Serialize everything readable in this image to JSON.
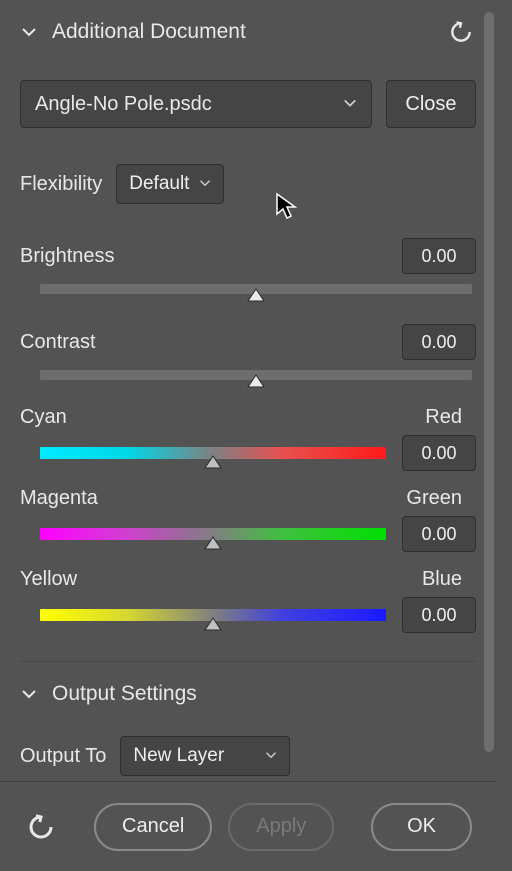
{
  "sections": {
    "additional_document": {
      "title": "Additional Document",
      "file_selected": "Angle-No Pole.psdc",
      "close_label": "Close",
      "flexibility_label": "Flexibility",
      "flexibility_value": "Default",
      "sliders": {
        "brightness": {
          "label": "Brightness",
          "value": "0.00"
        },
        "contrast": {
          "label": "Contrast",
          "value": "0.00"
        },
        "cyan_red": {
          "left": "Cyan",
          "right": "Red",
          "value": "0.00"
        },
        "mag_green": {
          "left": "Magenta",
          "right": "Green",
          "value": "0.00"
        },
        "yel_blue": {
          "left": "Yellow",
          "right": "Blue",
          "value": "0.00"
        }
      }
    },
    "output_settings": {
      "title": "Output Settings",
      "output_to_label": "Output To",
      "output_to_value": "New Layer"
    }
  },
  "footer": {
    "cancel": "Cancel",
    "apply": "Apply",
    "ok": "OK"
  }
}
